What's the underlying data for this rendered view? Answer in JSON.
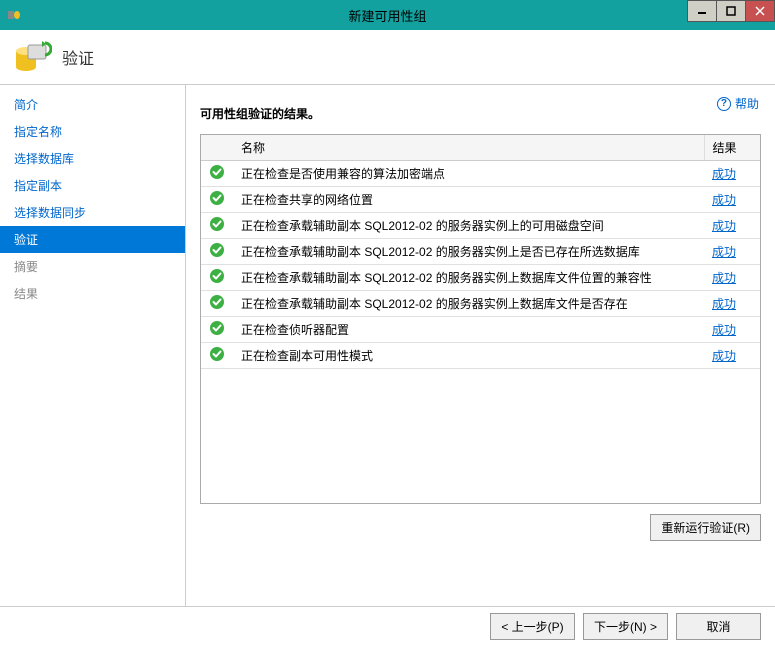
{
  "window": {
    "title": "新建可用性组"
  },
  "header": {
    "title": "验证"
  },
  "help": {
    "label": "帮助"
  },
  "sidebar": {
    "items": [
      {
        "label": "简介",
        "state": "link"
      },
      {
        "label": "指定名称",
        "state": "link"
      },
      {
        "label": "选择数据库",
        "state": "link"
      },
      {
        "label": "指定副本",
        "state": "link"
      },
      {
        "label": "选择数据同步",
        "state": "link"
      },
      {
        "label": "验证",
        "state": "selected"
      },
      {
        "label": "摘要",
        "state": "grey"
      },
      {
        "label": "结果",
        "state": "grey"
      }
    ]
  },
  "main": {
    "heading": "可用性组验证的结果。",
    "columns": {
      "name": "名称",
      "result": "结果"
    },
    "rows": [
      {
        "name": "正在检查是否使用兼容的算法加密端点",
        "result": "成功"
      },
      {
        "name": "正在检查共享的网络位置",
        "result": "成功"
      },
      {
        "name": "正在检查承载辅助副本 SQL2012-02 的服务器实例上的可用磁盘空间",
        "result": "成功"
      },
      {
        "name": "正在检查承载辅助副本 SQL2012-02 的服务器实例上是否已存在所选数据库",
        "result": "成功"
      },
      {
        "name": "正在检查承载辅助副本 SQL2012-02 的服务器实例上数据库文件位置的兼容性",
        "result": "成功"
      },
      {
        "name": "正在检查承载辅助副本 SQL2012-02 的服务器实例上数据库文件是否存在",
        "result": "成功"
      },
      {
        "name": "正在检查侦听器配置",
        "result": "成功"
      },
      {
        "name": "正在检查副本可用性模式",
        "result": "成功"
      }
    ],
    "rerun_label": "重新运行验证(R)"
  },
  "footer": {
    "prev": "< 上一步(P)",
    "next": "下一步(N) >",
    "cancel": "取消"
  }
}
